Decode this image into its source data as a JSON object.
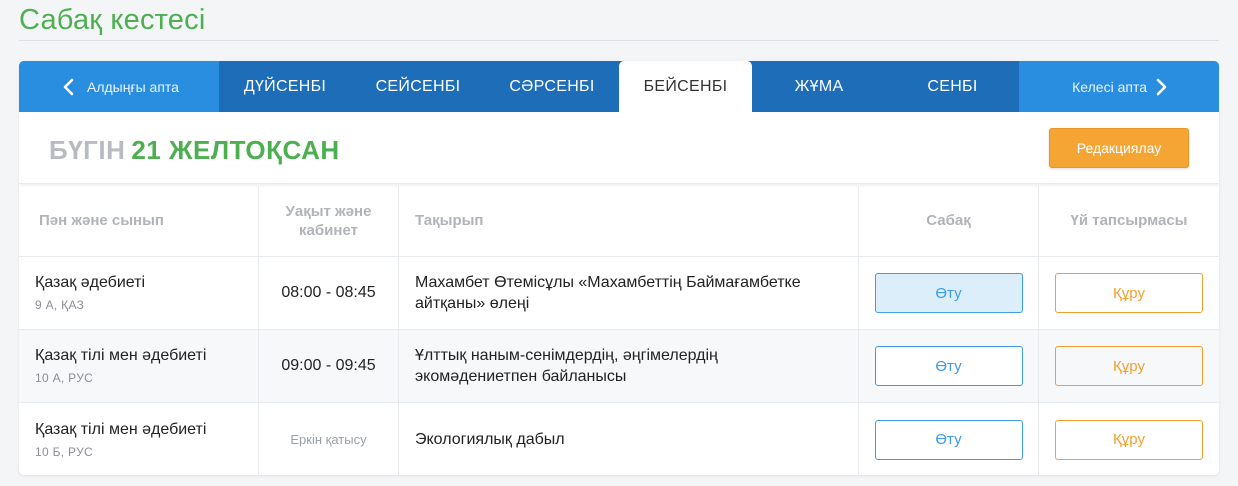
{
  "page": {
    "title": "Сабақ кестесі"
  },
  "week_nav": {
    "prev_label": "Алдыңғы апта",
    "next_label": "Келесі апта",
    "days": [
      "ДҮЙСЕНБІ",
      "СЕЙСЕНБІ",
      "СӘРСЕНБІ",
      "БЕЙСЕНБІ",
      "ЖҰМА",
      "СЕНБІ"
    ],
    "active_day": "БЕЙСЕНБІ"
  },
  "today": {
    "prefix": "БҮГІН",
    "date": "21 ЖЕЛТОҚСАН"
  },
  "edit_button": "Редакциялау",
  "table": {
    "headers": [
      "Пән және сынып",
      "Уақыт және кабинет",
      "Тақырып",
      "Сабақ",
      "Үй тапсырмасы"
    ],
    "rows": [
      {
        "subject": "Қазақ әдебиеті",
        "class": "9 А, ҚАЗ",
        "time": "08:00 - 08:45",
        "topic": "Махамбет Өтемісұлы «Махамбеттің Баймағамбетке айтқаны» өлеңі",
        "lesson_btn": "Өту",
        "homework_btn": "Құру"
      },
      {
        "subject": "Қазақ тілі мен әдебиеті",
        "class": "10 А, РУС",
        "time": "09:00 - 09:45",
        "topic": "Ұлттық наным-сенімдердің, әңгімелердің экомәдениетпен байланысы",
        "lesson_btn": "Өту",
        "homework_btn": "Құру"
      },
      {
        "subject": "Қазақ тілі мен әдебиеті",
        "class": "10 Б, РУС",
        "time": "Еркін қатысу",
        "topic": "Экологиялық дабыл",
        "lesson_btn": "Өту",
        "homework_btn": "Құру"
      }
    ]
  },
  "colors": {
    "accent_green": "#4caf50",
    "tab_blue": "#1e6db8",
    "nav_blue": "#2a8ee0",
    "button_orange": "#f5a534",
    "link_blue": "#3d9be9"
  },
  "icons": {
    "prev": "chevron-left-icon",
    "next": "chevron-right-icon"
  }
}
